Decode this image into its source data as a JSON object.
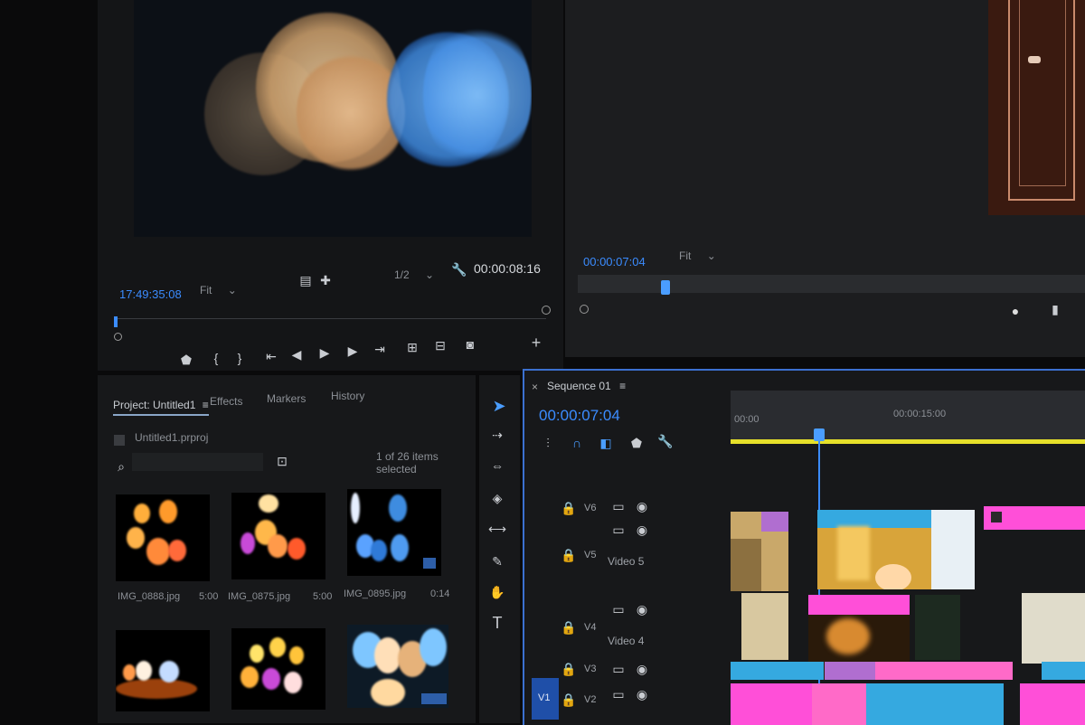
{
  "source_monitor": {
    "timecode_in": "17:49:35:08",
    "fit_label": "Fit",
    "resolution": "1/2",
    "timecode_out": "00:00:08:16"
  },
  "program_monitor": {
    "timecode": "00:00:07:04",
    "fit_label": "Fit"
  },
  "project_panel": {
    "tabs": [
      "Project: Untitled1",
      "Effects",
      "Markers",
      "History"
    ],
    "project_file": "Untitled1.prproj",
    "selection_status": "1 of 26 items selected",
    "items": [
      {
        "name": "IMG_0888.jpg",
        "duration": "5:00"
      },
      {
        "name": "IMG_0875.jpg",
        "duration": "5:00"
      },
      {
        "name": "IMG_0895.jpg",
        "duration": "0:14"
      }
    ]
  },
  "sequence": {
    "title": "Sequence 01",
    "timecode": "00:00:07:04",
    "ruler_start": "00:00",
    "ruler_mark": "00:00:15:00",
    "tracks": [
      {
        "id": "V6",
        "name": ""
      },
      {
        "id": "V5",
        "name": "Video 5"
      },
      {
        "id": "V4",
        "name": "Video 4"
      },
      {
        "id": "V3",
        "name": ""
      },
      {
        "id": "V2",
        "name": ""
      }
    ],
    "source_patch": "V1"
  },
  "colors": {
    "accent_blue": "#3b8cff",
    "clip_pink": "#ff4fd8",
    "clip_cyan": "#35a9e0",
    "work_area_yellow": "#e6e02a"
  }
}
